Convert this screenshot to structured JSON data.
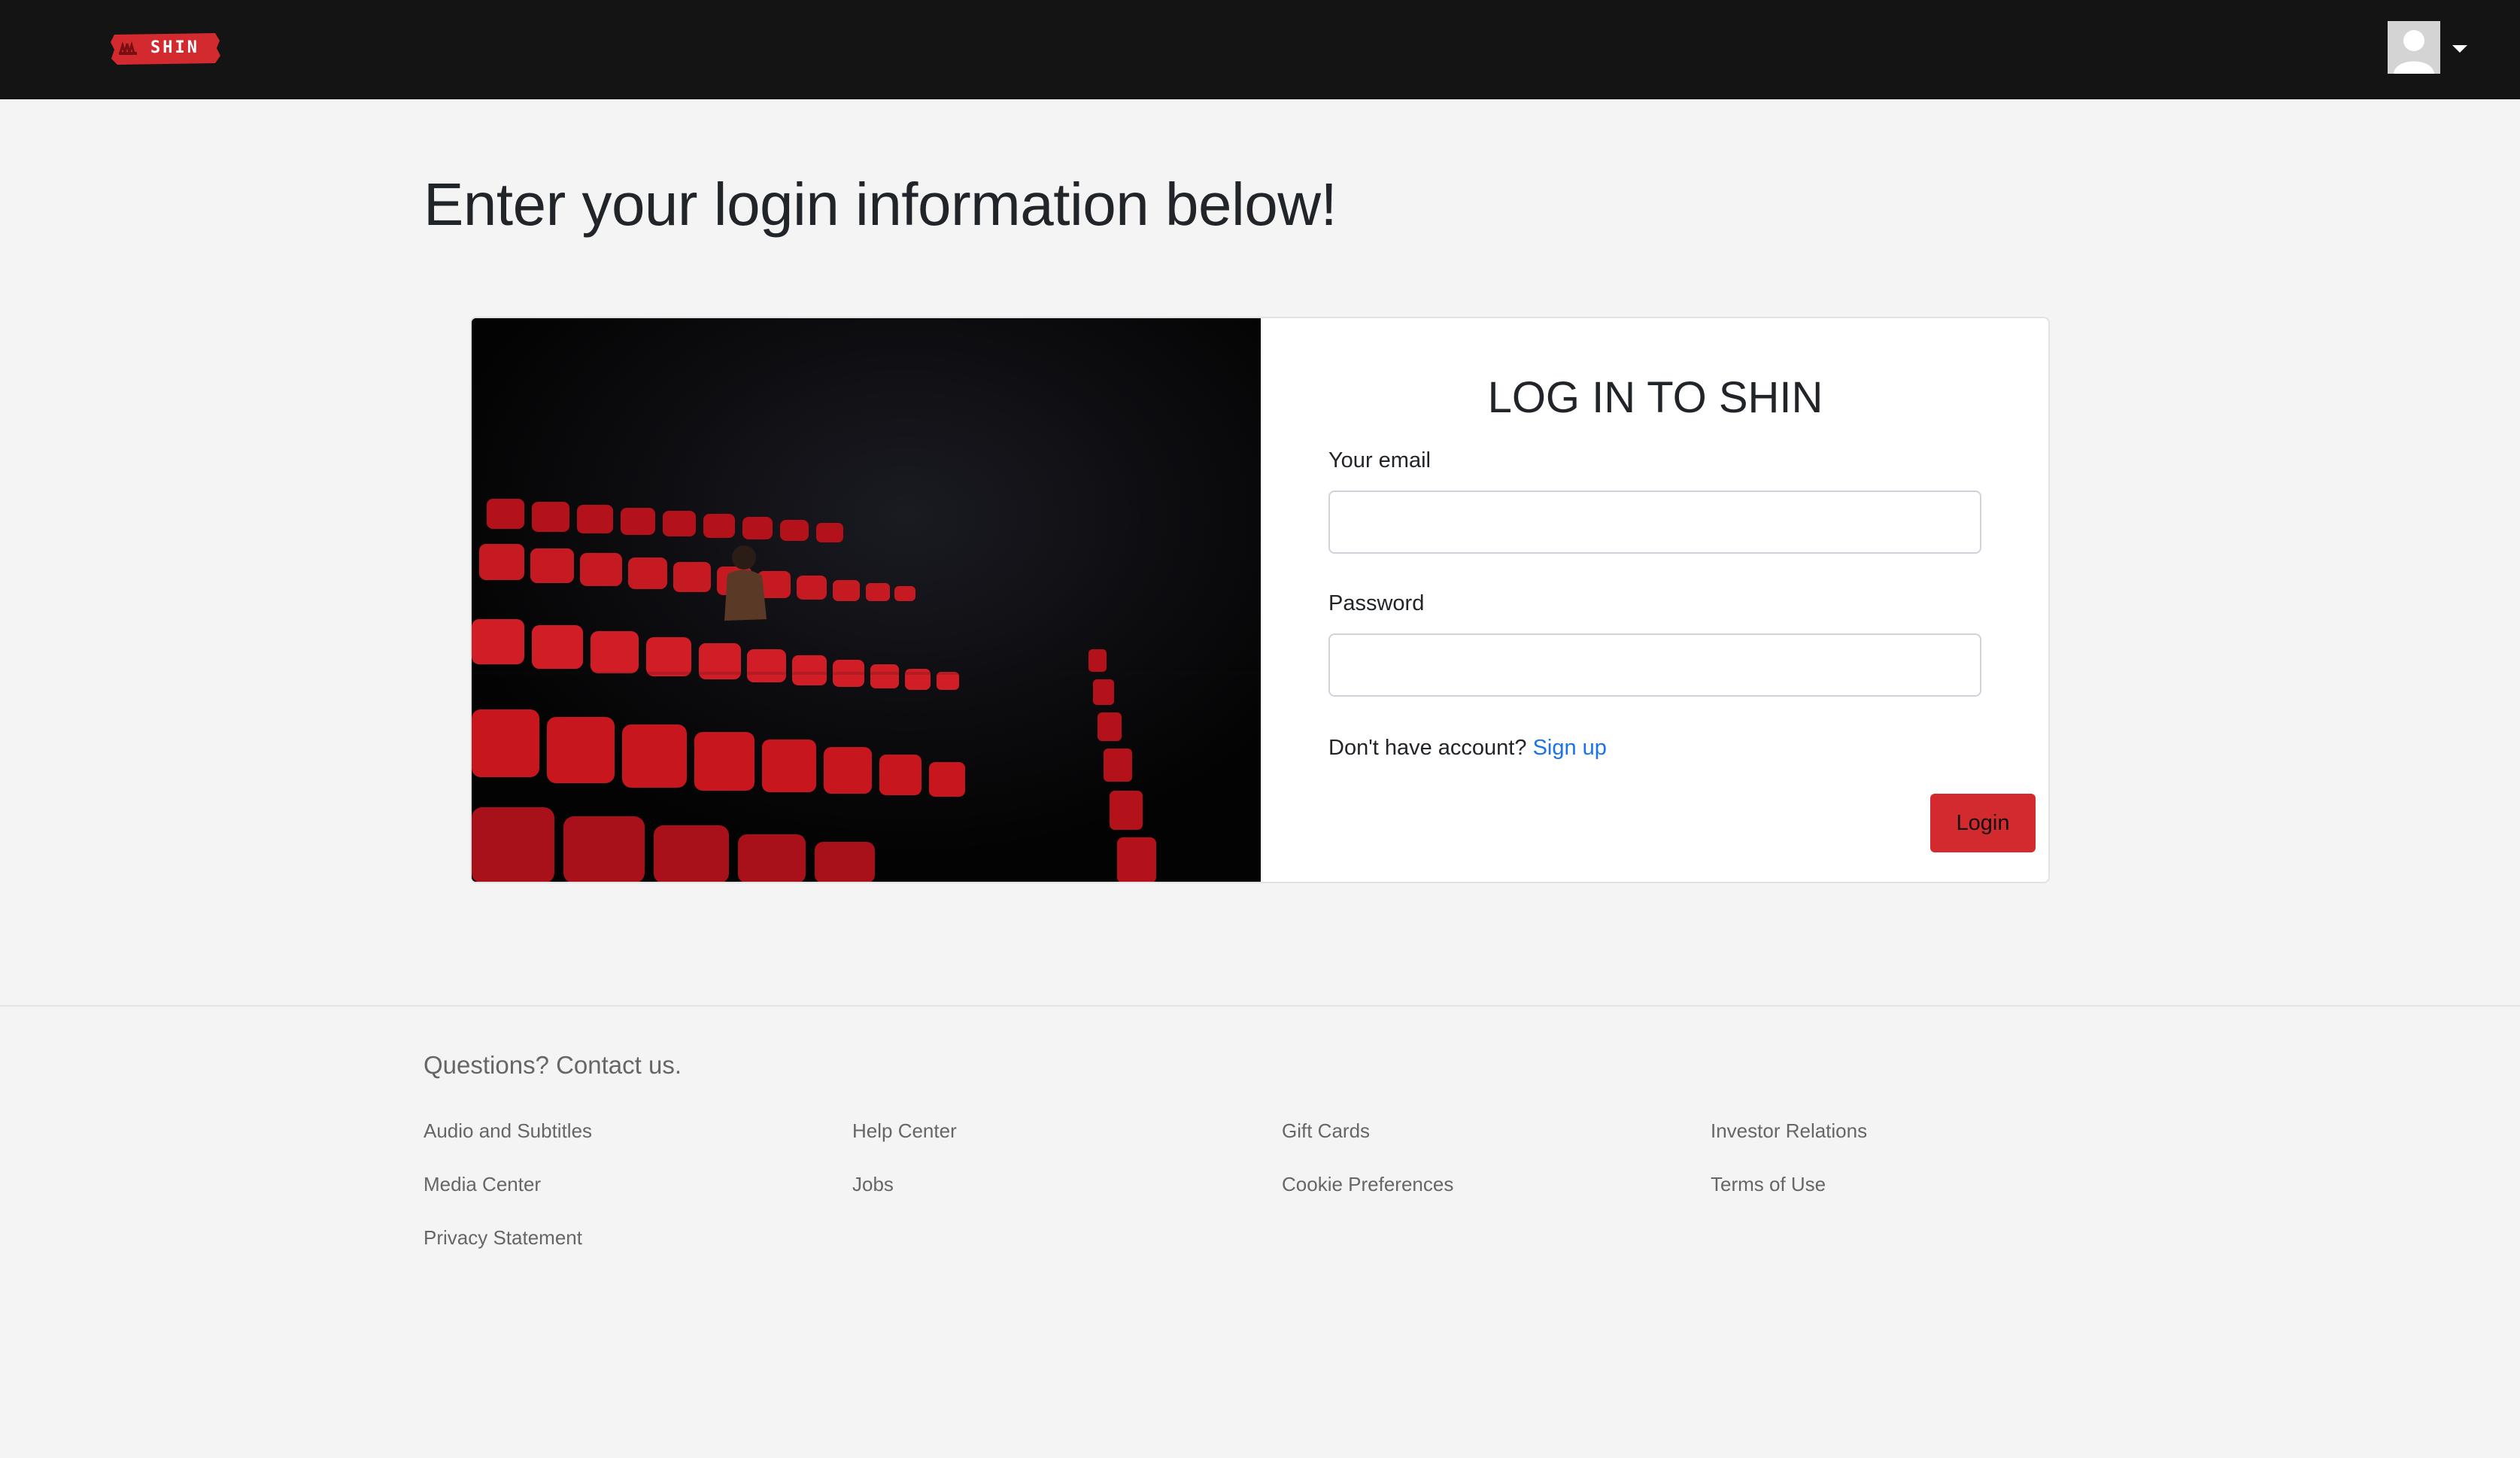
{
  "header": {
    "logo_text": "SHIN",
    "brand_color": "#d32a2f",
    "avatar_icon": "user-avatar-icon",
    "menu_icon": "caret-down-icon"
  },
  "main": {
    "heading": "Enter your login information below!"
  },
  "login_card": {
    "image_description": "cinema-seats-image",
    "title": "LOG IN TO SHIN",
    "email_label": "Your email",
    "email_value": "",
    "password_label": "Password",
    "password_value": "",
    "signup_prompt": "Don't have account?",
    "signup_link": "Sign up",
    "login_button": "Login"
  },
  "footer": {
    "title": "Questions? Contact us.",
    "columns": [
      [
        "Audio and Subtitles",
        "Media Center",
        "Privacy Statement"
      ],
      [
        "Help Center",
        "Jobs"
      ],
      [
        "Gift Cards",
        "Cookie Preferences"
      ],
      [
        "Investor Relations",
        "Terms of Use"
      ]
    ]
  }
}
